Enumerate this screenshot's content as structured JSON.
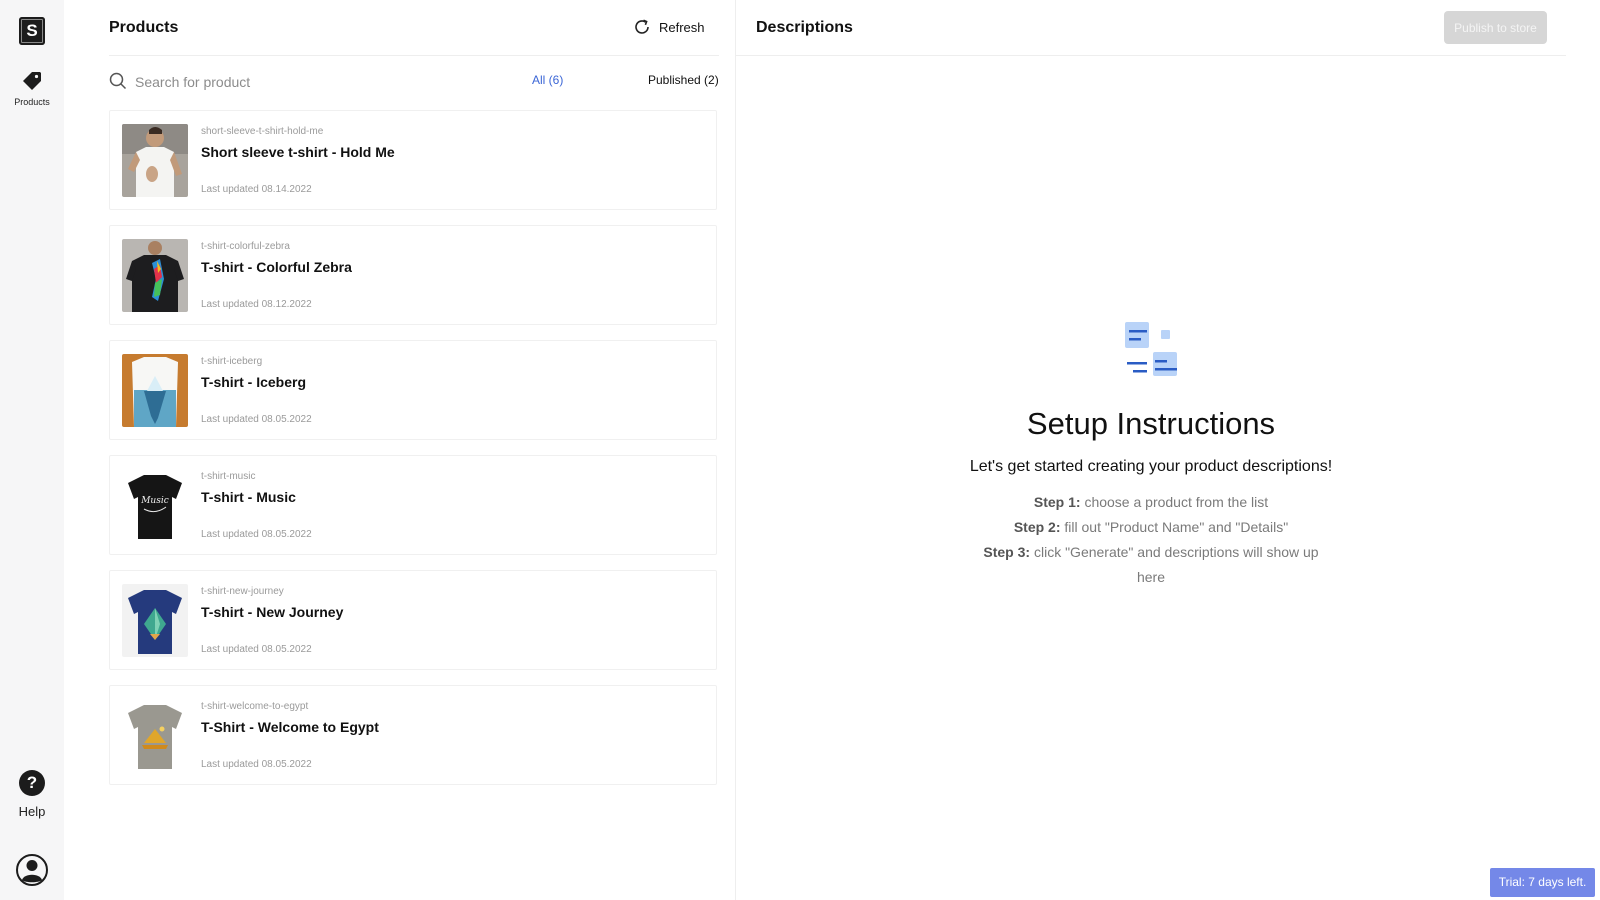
{
  "sidebar": {
    "logo_letter": "S",
    "products_label": "Products",
    "help_label": "Help"
  },
  "products_panel": {
    "title": "Products",
    "refresh_label": "Refresh",
    "search_placeholder": "Search for product",
    "tab_all": "All (6)",
    "tab_published": "Published (2)",
    "items": [
      {
        "slug": "short-sleeve-t-shirt-hold-me",
        "name": "Short sleeve t-shirt - Hold Me",
        "updated": "Last updated 08.14.2022"
      },
      {
        "slug": "t-shirt-colorful-zebra",
        "name": "T-shirt - Colorful Zebra",
        "updated": "Last updated 08.12.2022"
      },
      {
        "slug": "t-shirt-iceberg",
        "name": "T-shirt - Iceberg",
        "updated": "Last updated 08.05.2022"
      },
      {
        "slug": "t-shirt-music",
        "name": "T-shirt - Music",
        "updated": "Last updated 08.05.2022"
      },
      {
        "slug": "t-shirt-new-journey",
        "name": "T-shirt - New Journey",
        "updated": "Last updated 08.05.2022"
      },
      {
        "slug": "t-shirt-welcome-to-egypt",
        "name": "T-Shirt - Welcome to Egypt",
        "updated": "Last updated 08.05.2022"
      }
    ]
  },
  "descriptions_panel": {
    "title": "Descriptions",
    "publish_label": "Publish to store",
    "setup_title": "Setup Instructions",
    "setup_subtitle": "Let's get started creating your product descriptions!",
    "step1_label": "Step 1:",
    "step1_text": " choose a product from the list",
    "step2_label": "Step 2:",
    "step2_text": " fill out \"Product Name\" and \"Details\"",
    "step3_label": "Step 3:",
    "step3_text": " click \"Generate\" and descriptions will show up here"
  },
  "trial_badge": "Trial: 7 days left.",
  "colors": {
    "accent": "#3b66d6",
    "trial_badge": "#7488e8",
    "setup_icon_light": "#b9d3f8",
    "setup_icon_dark": "#2a5cc4"
  }
}
